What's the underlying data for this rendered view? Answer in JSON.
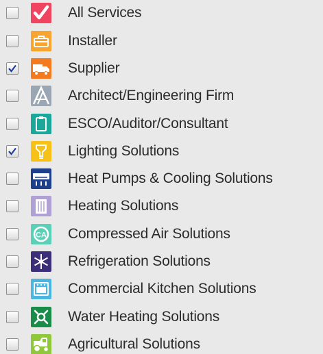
{
  "filters": [
    {
      "label": "All Services",
      "checked": false,
      "icon": "check-mark-icon",
      "color": "#ef4560"
    },
    {
      "label": "Installer",
      "checked": false,
      "icon": "toolbox-icon",
      "color": "#f7a530"
    },
    {
      "label": "Supplier",
      "checked": true,
      "icon": "delivery-truck-icon",
      "color": "#f37a1f"
    },
    {
      "label": "Architect/Engineering Firm",
      "checked": false,
      "icon": "drafting-tools-icon",
      "color": "#9aa6b4"
    },
    {
      "label": "ESCO/Auditor/Consultant",
      "checked": false,
      "icon": "clipboard-icon",
      "color": "#1ba89b"
    },
    {
      "label": "Lighting Solutions",
      "checked": true,
      "icon": "light-bulb-icon",
      "color": "#f6c21a"
    },
    {
      "label": "Heat Pumps & Cooling Solutions",
      "checked": false,
      "icon": "air-conditioner-icon",
      "color": "#1e3f8c"
    },
    {
      "label": "Heating Solutions",
      "checked": false,
      "icon": "radiator-icon",
      "color": "#b0a1d4"
    },
    {
      "label": "Compressed Air Solutions",
      "checked": false,
      "icon": "compressed-air-icon",
      "color": "#5ccfb7"
    },
    {
      "label": "Refrigeration Solutions",
      "checked": false,
      "icon": "snowflake-icon",
      "color": "#3b2f7a"
    },
    {
      "label": "Commercial Kitchen Solutions",
      "checked": false,
      "icon": "oven-icon",
      "color": "#4cb6e0"
    },
    {
      "label": "Water Heating Solutions",
      "checked": false,
      "icon": "water-heater-icon",
      "color": "#1a8c4a"
    },
    {
      "label": "Agricultural Solutions",
      "checked": false,
      "icon": "tractor-icon",
      "color": "#8fc83a"
    }
  ]
}
